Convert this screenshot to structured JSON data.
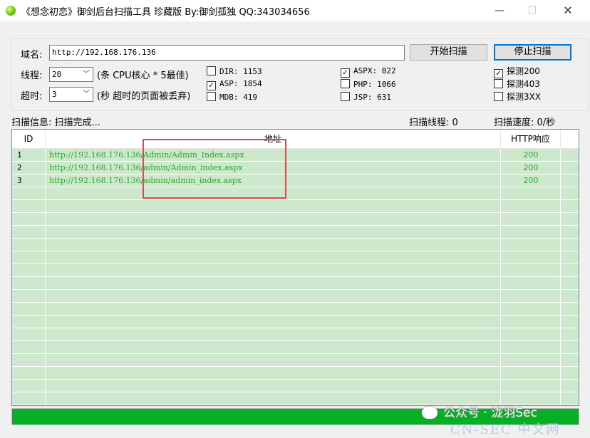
{
  "window": {
    "title": "《想念初恋》御剑后台扫描工具 珍藏版 By:御剑孤独 QQ:343034656",
    "minimize_icon": "—",
    "maximize_icon": "☐",
    "close_icon": "✕"
  },
  "form": {
    "domain_label": "域名:",
    "domain_value": "http://192.168.176.136",
    "start_button": "开始扫描",
    "stop_button": "停止扫描",
    "threads_label": "线程:",
    "threads_value": "20",
    "threads_hint": "(条 CPU核心 * 5最佳)",
    "timeout_label": "超时:",
    "timeout_value": "3",
    "timeout_hint": "(秒 超时的页面被丢弃)"
  },
  "dicts": [
    {
      "label": "DIR: 1153",
      "checked": false
    },
    {
      "label": "ASP: 1854",
      "checked": true
    },
    {
      "label": "MDB: 419",
      "checked": false
    },
    {
      "label": "ASPX: 822",
      "checked": true
    },
    {
      "label": "PHP: 1066",
      "checked": false
    },
    {
      "label": "JSP: 631",
      "checked": false
    }
  ],
  "probes": [
    {
      "label": "探测200",
      "checked": true
    },
    {
      "label": "探测403",
      "checked": false
    },
    {
      "label": "探测3XX",
      "checked": false
    }
  ],
  "status": {
    "info": "扫描信息: 扫描完成...",
    "threads": "扫描线程: 0",
    "speed": "扫描速度: 0/秒"
  },
  "table": {
    "columns": [
      "ID",
      "地址",
      "HTTP响应"
    ],
    "rows": [
      {
        "id": "1",
        "url": "http://192.168.176.136/Admin/Admin_Index.aspx",
        "code": "200"
      },
      {
        "id": "2",
        "url": "http://192.168.176.136/admin/Admin_index.aspx",
        "code": "200"
      },
      {
        "id": "3",
        "url": "http://192.168.176.136/admin/admin_index.aspx",
        "code": "200"
      }
    ]
  },
  "progress": {
    "percent": 100
  },
  "colors": {
    "progress": "#06b025",
    "result_text": "#2aa82a",
    "row_fill": "#cde8cd",
    "highlight": "#e0474c"
  },
  "watermark": {
    "text": "公众号 · 泷羽Sec",
    "text2": "CN-SEC 中文网"
  }
}
